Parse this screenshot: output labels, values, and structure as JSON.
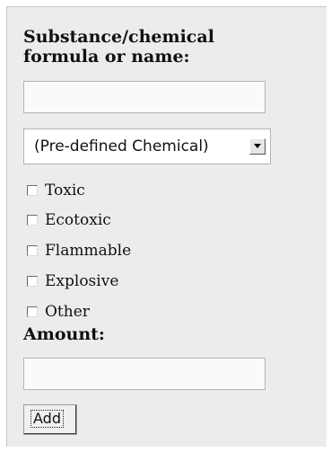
{
  "form": {
    "substance_heading": "Substance/chemical formula or name:",
    "substance_input_value": "",
    "chemical_select_value": "(Pre-defined Chemical)",
    "hazards": [
      {
        "label": "Toxic",
        "checked": false
      },
      {
        "label": "Ecotoxic",
        "checked": false
      },
      {
        "label": "Flammable",
        "checked": false
      },
      {
        "label": "Explosive",
        "checked": false
      },
      {
        "label": "Other",
        "checked": false
      }
    ],
    "amount_heading": "Amount:",
    "amount_input_value": "",
    "add_label": "Add"
  }
}
